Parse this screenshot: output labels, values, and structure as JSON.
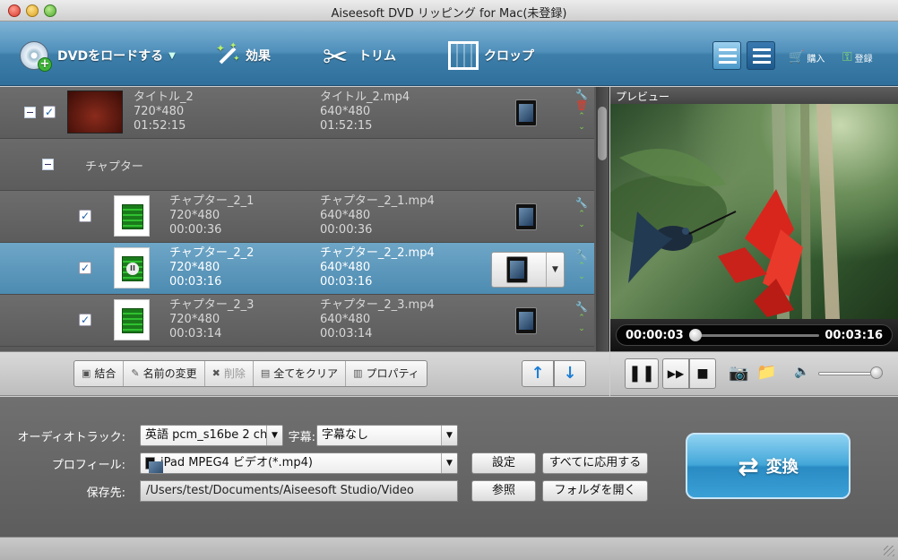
{
  "window": {
    "title": "Aiseesoft DVD リッピング for Mac(未登録)"
  },
  "toolbar": {
    "load_dvd": "DVDをロードする",
    "effect": "効果",
    "trim": "トリム",
    "crop": "クロップ",
    "buy": "購入",
    "register": "登録"
  },
  "list": {
    "title_row": {
      "name": "タイトル_2",
      "res": "720*480",
      "dur": "01:52:15",
      "out_name": "タイトル_2.mp4",
      "out_res": "640*480",
      "out_dur": "01:52:15"
    },
    "chapter_header": "チャプター",
    "chapters": [
      {
        "name": "チャプター_2_1",
        "res": "720*480",
        "dur": "00:00:36",
        "out_name": "チャプター_2_1.mp4",
        "out_res": "640*480",
        "out_dur": "00:00:36"
      },
      {
        "name": "チャプター_2_2",
        "res": "720*480",
        "dur": "00:03:16",
        "out_name": "チャプター_2_2.mp4",
        "out_res": "640*480",
        "out_dur": "00:03:16"
      },
      {
        "name": "チャプター_2_3",
        "res": "720*480",
        "dur": "00:03:14",
        "out_name": "チャプター_2_3.mp4",
        "out_res": "640*480",
        "out_dur": "00:03:14"
      }
    ]
  },
  "preview": {
    "title": "プレビュー",
    "current_time": "00:00:03",
    "total_time": "00:03:16",
    "progress": 0.015,
    "volume": 0.9
  },
  "actions": {
    "merge": "結合",
    "rename": "名前の変更",
    "delete": "削除",
    "clear_all": "全てをクリア",
    "properties": "プロパティ"
  },
  "settings": {
    "audio_track_label": "オーディオトラック:",
    "audio_track_value": "英語 pcm_s16be 2 ch",
    "subtitle_label": "字幕:",
    "subtitle_value": "字幕なし",
    "profile_label": "プロフィール:",
    "profile_value": "iPad MPEG4 ビデオ(*.mp4)",
    "destination_label": "保存先:",
    "destination_value": "/Users/test/Documents/Aiseesoft Studio/Video",
    "settings_btn": "設定",
    "apply_all_btn": "すべてに応用する",
    "browse_btn": "参照",
    "open_folder_btn": "フォルダを開く",
    "convert_btn": "変換"
  }
}
